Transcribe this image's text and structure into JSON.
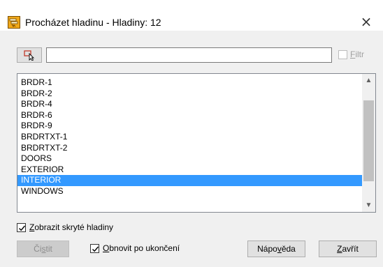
{
  "window": {
    "title": "Procházet hladinu - Hladiny: 12",
    "close_glyph": "×"
  },
  "filter": {
    "value": "",
    "checkbox_checked": false,
    "label_accel": "F",
    "label_rest": "iltr"
  },
  "layers": {
    "items": [
      "BRDR-1",
      "BRDR-2",
      "BRDR-4",
      "BRDR-6",
      "BRDR-9",
      "BRDRTXT-1",
      "BRDRTXT-2",
      "DOORS",
      "EXTERIOR",
      "INTERIOR",
      "WINDOWS"
    ],
    "selected": "INTERIOR"
  },
  "options": {
    "show_hidden": {
      "accel": "Z",
      "rest": "obrazit skryté hladiny",
      "checked": true
    },
    "restore": {
      "accel": "O",
      "rest": "bnovit po ukončení",
      "checked": true
    }
  },
  "buttons": {
    "clear": {
      "pre": "Či",
      "accel": "s",
      "post": "tit",
      "enabled": false
    },
    "help": {
      "pre": "Nápo",
      "accel": "v",
      "post": "ěda"
    },
    "close": {
      "pre": "",
      "accel": "Z",
      "post": "avřít"
    }
  },
  "icons": {
    "app": "layer-walk-icon",
    "pick": "select-objects-icon",
    "close": "close-icon"
  },
  "colors": {
    "selection": "#3399ff",
    "dialog_bg": "#f0f0f0",
    "app_icon": "#f0a81a"
  }
}
